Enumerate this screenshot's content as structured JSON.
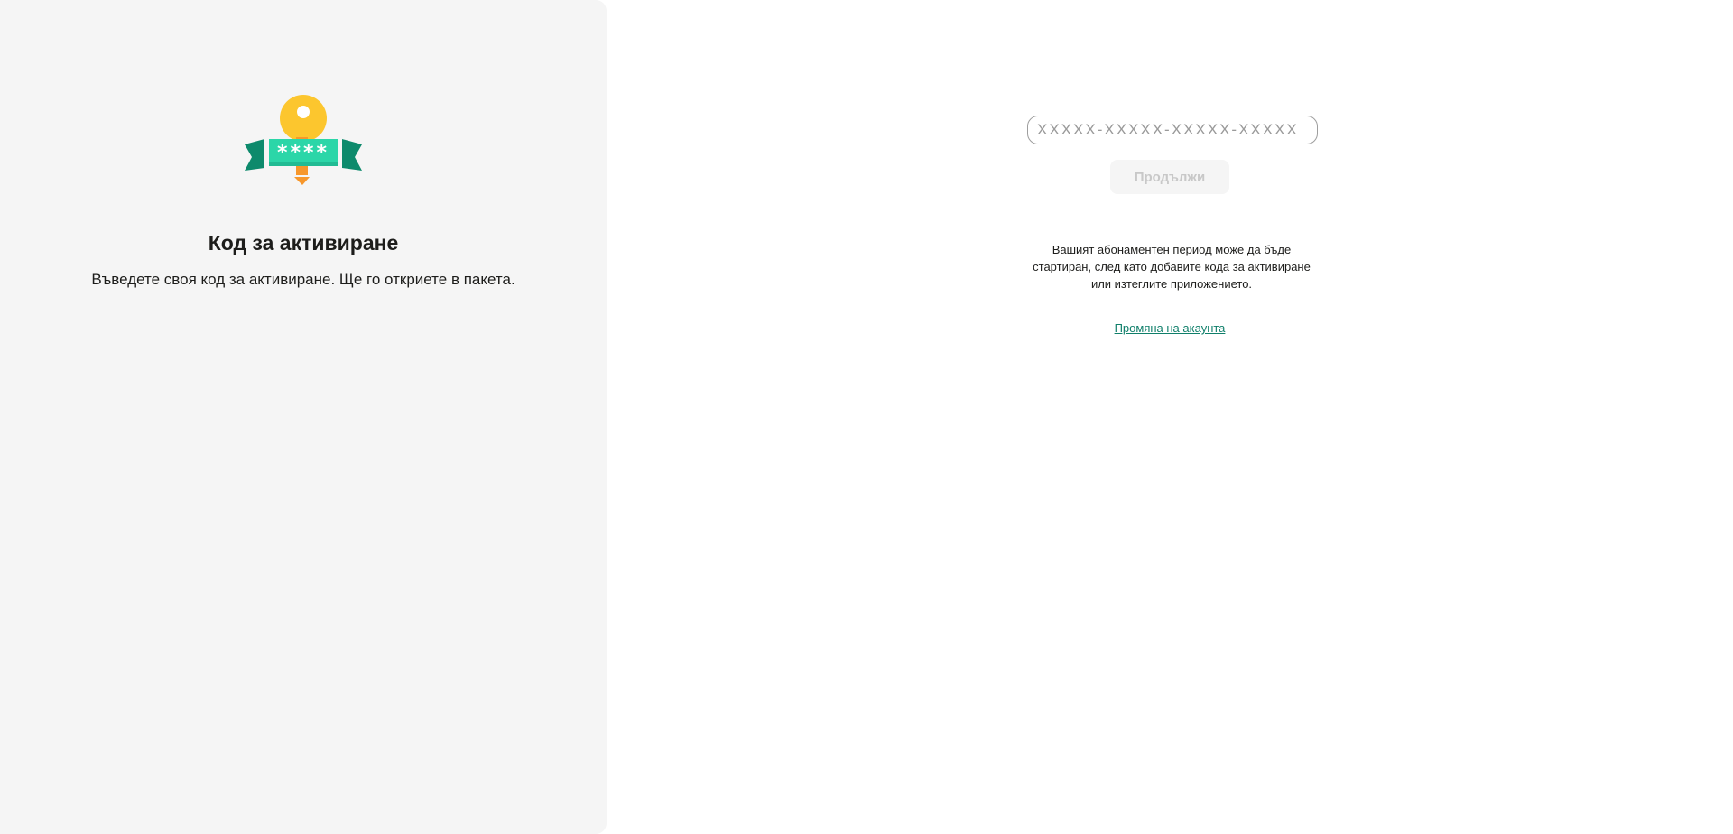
{
  "left": {
    "title": "Код за активиране",
    "subtitle": "Въведете своя код за активиране. Ще го откриете в пакета.",
    "illustration": {
      "icon": "activation-key-icon",
      "masked_code": "****",
      "colors": {
        "key": "#fcc62e",
        "key_handle": "#f7972b",
        "ribbon_front": "#2bd6a8",
        "ribbon_back": "#0d8a6c"
      }
    }
  },
  "form": {
    "code_placeholder": "XXXXX-XXXXX-XXXXX-XXXXX",
    "code_value": "",
    "continue_label": "Продължи",
    "continue_enabled": false
  },
  "info": {
    "text": "Вашият абонаментен период може да бъде стартиран, след като добавите кода за активиране или изтеглите приложението."
  },
  "links": {
    "change_account": "Промяна на акаунта"
  },
  "colors": {
    "panel_bg": "#f5f5f5",
    "accent_link": "#0f7f6a",
    "disabled_text": "#c8c8c8"
  }
}
